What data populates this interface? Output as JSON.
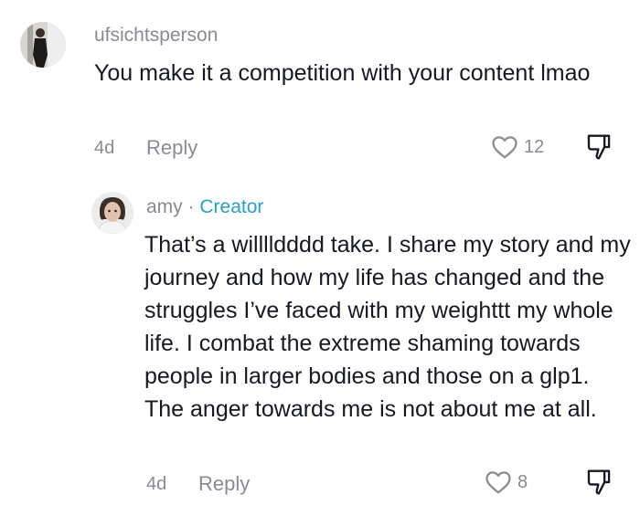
{
  "comment1": {
    "username": "ufsichtsperson",
    "text": "You make it a competition with your content lmao",
    "date": "4d",
    "reply_label": "Reply",
    "likes": "12"
  },
  "comment2": {
    "username": "amy",
    "separator": " · ",
    "badge": "Creator",
    "text": "That’s a willlldddd take. I share my story and my journey and how my life has changed and the struggles I’ve faced with my weighttt my whole life. I combat the extreme shaming towards people in larger bodies and those on a glp1. The anger towards me is not about me at all.",
    "date": "4d",
    "reply_label": "Reply",
    "likes": "8"
  },
  "colors": {
    "text": "#161823",
    "meta": "#8a8b91",
    "creator": "#2a9fc9"
  },
  "icons": [
    "heart-outline-icon",
    "thumbs-down-icon"
  ]
}
